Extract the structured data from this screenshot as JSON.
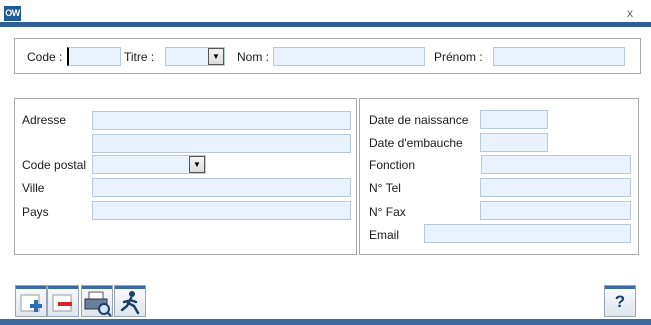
{
  "window": {
    "app_logo": "OW",
    "close_glyph": "x",
    "accent_color": "#2f5f95",
    "field_bg": "#eaf2fd"
  },
  "search": {
    "code_label": "Code :",
    "code_value": "",
    "titre_label": "Titre :",
    "titre_value": "",
    "nom_label": "Nom :",
    "nom_value": "",
    "prenom_label": "Prénom :",
    "prenom_value": ""
  },
  "address": {
    "adresse_label": "Adresse",
    "adresse_line1": "",
    "adresse_line2": "",
    "code_postal_label": "Code postal",
    "code_postal_value": "",
    "ville_label": "Ville",
    "ville_value": "",
    "pays_label": "Pays",
    "pays_value": ""
  },
  "employment": {
    "date_naissance_label": "Date de naissance",
    "date_naissance_value": "",
    "date_embauche_label": "Date d'embauche",
    "date_embauche_value": "",
    "fonction_label": "Fonction",
    "fonction_value": "",
    "tel_label": "N° Tel",
    "tel_value": "",
    "fax_label": "N° Fax",
    "fax_value": "",
    "email_label": "Email",
    "email_value": ""
  },
  "toolbar": {
    "add_icon": "add-record-icon",
    "delete_icon": "delete-record-icon",
    "print_icon": "print-preview-icon",
    "exit_icon": "exit-running-man-icon",
    "help_glyph": "?"
  }
}
